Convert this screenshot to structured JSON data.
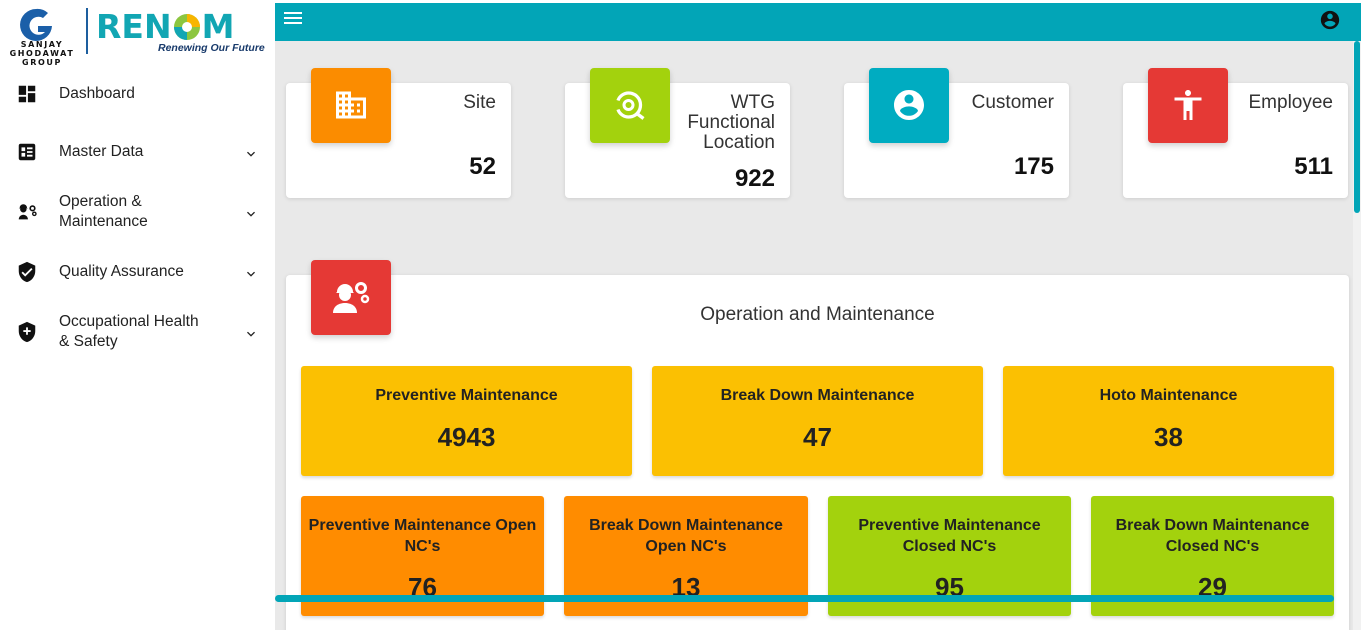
{
  "brand": {
    "group_name": "SANJAY GHODAWAT GROUP",
    "logo_text": "REN",
    "logo_text_end": "M",
    "tagline": "Renewing Our Future",
    "accent": "#02a5b7"
  },
  "sidebar": {
    "items": [
      {
        "label": "Dashboard",
        "icon": "dashboard-icon",
        "expandable": false
      },
      {
        "label": "Master Data",
        "icon": "master-data-icon",
        "expandable": true
      },
      {
        "label": "Operation &\nMaintenance",
        "icon": "engineer-gear-icon",
        "expandable": true
      },
      {
        "label": "Quality Assurance",
        "icon": "shield-check-icon",
        "expandable": true
      },
      {
        "label": "Occupational Health\n& Safety",
        "icon": "shield-plus-icon",
        "expandable": true
      }
    ]
  },
  "topbar": {
    "menu_icon": "hamburger-icon",
    "account_icon": "account-circle-icon"
  },
  "stats": [
    {
      "label": "Site",
      "value": "52",
      "icon": "building-icon",
      "color": "#fb8c00"
    },
    {
      "label": "WTG\nFunctional\nLocation",
      "value": "922",
      "icon": "wind-turbine-icon",
      "color": "#a3d20d"
    },
    {
      "label": "Customer",
      "value": "175",
      "icon": "person-circle-icon",
      "color": "#00acc1"
    },
    {
      "label": "Employee",
      "value": "511",
      "icon": "accessibility-icon",
      "color": "#e53935"
    }
  ],
  "operation_maintenance": {
    "title": "Operation and Maintenance",
    "icon": "engineer-gear-icon",
    "row1": [
      {
        "label": "Preventive Maintenance",
        "value": "4943"
      },
      {
        "label": "Break Down Maintenance",
        "value": "47"
      },
      {
        "label": "Hoto Maintenance",
        "value": "38"
      }
    ],
    "row2": [
      {
        "label": "Preventive Maintenance Open NC's",
        "value": "76",
        "color": "orange"
      },
      {
        "label": "Break Down Maintenance Open NC's",
        "value": "13",
        "color": "orange"
      },
      {
        "label": "Preventive Maintenance Closed NC's",
        "value": "95",
        "color": "green"
      },
      {
        "label": "Break Down Maintenance Closed NC's",
        "value": "29",
        "color": "green"
      }
    ]
  }
}
